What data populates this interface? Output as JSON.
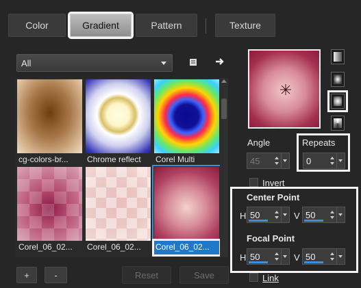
{
  "tabs": [
    {
      "label": "Color"
    },
    {
      "label": "Gradient"
    },
    {
      "label": "Pattern"
    },
    {
      "label": "Texture"
    }
  ],
  "active_tab": "Gradient",
  "category": {
    "selected": "All"
  },
  "gallery": {
    "items": [
      {
        "caption": "cg-colors-br..."
      },
      {
        "caption": "Chrome reflect"
      },
      {
        "caption": "Corel Multi"
      },
      {
        "caption": "Corel_06_02..."
      },
      {
        "caption": "Corel_06_02..."
      },
      {
        "caption": "Corel_06_02..."
      }
    ],
    "selected_index": 5
  },
  "buttons": {
    "add": "+",
    "remove": "-",
    "reset": "Reset",
    "save": "Save"
  },
  "settings": {
    "angle_label": "Angle",
    "angle_value": "45",
    "repeats_label": "Repeats",
    "repeats_value": "0",
    "invert_label": "Invert",
    "center_point_label": "Center Point",
    "center_h_label": "H",
    "center_h_value": "50",
    "center_v_label": "V",
    "center_v_value": "50",
    "focal_point_label": "Focal Point",
    "focal_h_label": "H",
    "focal_h_value": "50",
    "focal_v_label": "V",
    "focal_v_value": "50",
    "link_label": "Link"
  },
  "colors": {
    "accent": "#3e8fd6",
    "background": "#262626",
    "highlight": "#f4f4f4"
  },
  "icons": {
    "library": "book-icon",
    "export": "arrow-right-icon",
    "center_marker": "crosshair-star-icon"
  }
}
